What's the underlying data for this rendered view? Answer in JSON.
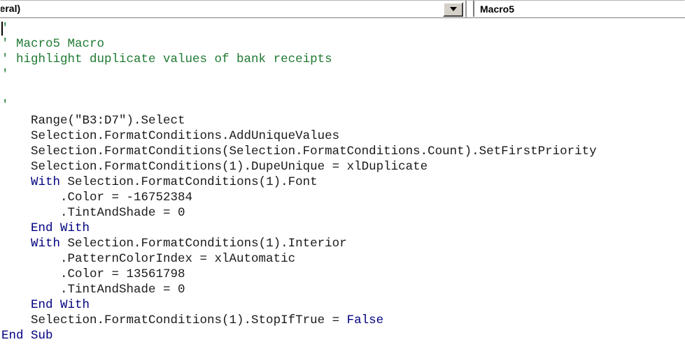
{
  "app": "vba-editor-code-window",
  "toolbar": {
    "declarations_combo": {
      "name": "object-combo",
      "visible_value": "neral)",
      "full_value": "(General)",
      "dropdown_icon": "chevron-down-icon"
    },
    "procedure_combo": {
      "name": "procedure-combo",
      "value": "Macro5",
      "dropdown_icon": "chevron-down-icon"
    }
  },
  "code": {
    "language": "vba",
    "caret_line": 1,
    "caret_column": 1,
    "colors": {
      "comment": "#1f7a33",
      "keyword": "#00007f",
      "plain": "#1a1a1a",
      "background": "#ffffff"
    },
    "lines": [
      {
        "n": 1,
        "tokens": [
          {
            "t": "comment",
            "s": "'"
          }
        ]
      },
      {
        "n": 2,
        "tokens": [
          {
            "t": "comment",
            "s": "' Macro5 Macro"
          }
        ]
      },
      {
        "n": 3,
        "tokens": [
          {
            "t": "comment",
            "s": "' highlight duplicate values of bank receipts"
          }
        ]
      },
      {
        "n": 4,
        "tokens": [
          {
            "t": "comment",
            "s": "'"
          }
        ]
      },
      {
        "n": 5,
        "tokens": [
          {
            "t": "plain",
            "s": ""
          }
        ]
      },
      {
        "n": 6,
        "tokens": [
          {
            "t": "comment",
            "s": "'"
          }
        ]
      },
      {
        "n": 7,
        "tokens": [
          {
            "t": "plain",
            "s": "    Range(\"B3:D7\").Select"
          }
        ]
      },
      {
        "n": 8,
        "tokens": [
          {
            "t": "plain",
            "s": "    Selection.FormatConditions.AddUniqueValues"
          }
        ]
      },
      {
        "n": 9,
        "tokens": [
          {
            "t": "plain",
            "s": "    Selection.FormatConditions(Selection.FormatConditions.Count).SetFirstPriority"
          }
        ]
      },
      {
        "n": 10,
        "tokens": [
          {
            "t": "plain",
            "s": "    Selection.FormatConditions(1).DupeUnique = xlDuplicate"
          }
        ]
      },
      {
        "n": 11,
        "tokens": [
          {
            "t": "plain",
            "s": "    "
          },
          {
            "t": "kw",
            "s": "With"
          },
          {
            "t": "plain",
            "s": " Selection.FormatConditions(1).Font"
          }
        ]
      },
      {
        "n": 12,
        "tokens": [
          {
            "t": "plain",
            "s": "        .Color = -16752384"
          }
        ]
      },
      {
        "n": 13,
        "tokens": [
          {
            "t": "plain",
            "s": "        .TintAndShade = 0"
          }
        ]
      },
      {
        "n": 14,
        "tokens": [
          {
            "t": "plain",
            "s": "    "
          },
          {
            "t": "kw",
            "s": "End With"
          }
        ]
      },
      {
        "n": 15,
        "tokens": [
          {
            "t": "plain",
            "s": "    "
          },
          {
            "t": "kw",
            "s": "With"
          },
          {
            "t": "plain",
            "s": " Selection.FormatConditions(1).Interior"
          }
        ]
      },
      {
        "n": 16,
        "tokens": [
          {
            "t": "plain",
            "s": "        .PatternColorIndex = xlAutomatic"
          }
        ]
      },
      {
        "n": 17,
        "tokens": [
          {
            "t": "plain",
            "s": "        .Color = 13561798"
          }
        ]
      },
      {
        "n": 18,
        "tokens": [
          {
            "t": "plain",
            "s": "        .TintAndShade = 0"
          }
        ]
      },
      {
        "n": 19,
        "tokens": [
          {
            "t": "plain",
            "s": "    "
          },
          {
            "t": "kw",
            "s": "End With"
          }
        ]
      },
      {
        "n": 20,
        "tokens": [
          {
            "t": "plain",
            "s": "    Selection.FormatConditions(1).StopIfTrue = "
          },
          {
            "t": "kw",
            "s": "False"
          }
        ]
      },
      {
        "n": 21,
        "tokens": [
          {
            "t": "kw",
            "s": "End Sub"
          }
        ]
      }
    ]
  }
}
